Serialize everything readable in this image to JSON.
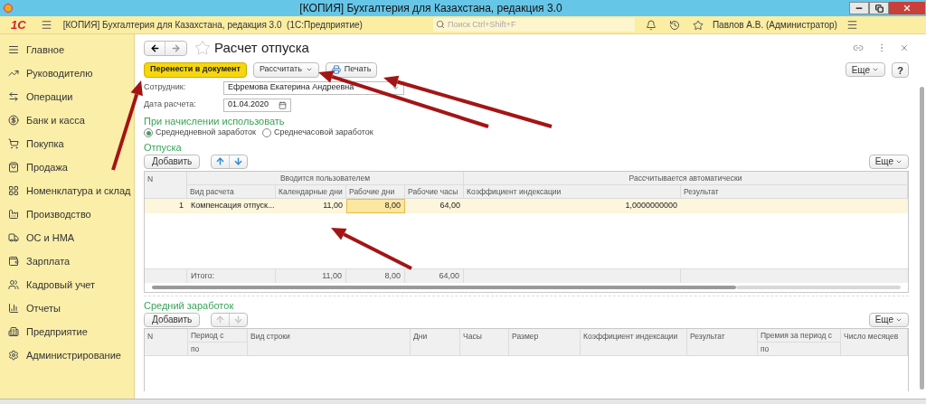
{
  "window": {
    "title": "[КОПИЯ] Бухгалтерия для Казахстана, редакция 3.0"
  },
  "app_bar": {
    "logo": "1С",
    "title": "[КОПИЯ] Бухгалтерия для Казахстана, редакция 3.0  (1С:Предприятие)",
    "search": {
      "placeholder": "Поиск Ctrl+Shift+F"
    },
    "user": "Павлов А.В. (Администратор)"
  },
  "sidebar": {
    "items": [
      {
        "label": "Главное"
      },
      {
        "label": "Руководителю"
      },
      {
        "label": "Операции"
      },
      {
        "label": "Банк и касса"
      },
      {
        "label": "Покупка"
      },
      {
        "label": "Продажа"
      },
      {
        "label": "Номенклатура и склад"
      },
      {
        "label": "Производство"
      },
      {
        "label": "ОС и НМА"
      },
      {
        "label": "Зарплата"
      },
      {
        "label": "Кадровый учет"
      },
      {
        "label": "Отчеты"
      },
      {
        "label": "Предприятие"
      },
      {
        "label": "Администрирование"
      }
    ]
  },
  "form": {
    "title": "Расчет отпуска",
    "more": "Еще",
    "help": "?",
    "buttons": [
      {
        "label": "Перенести в документ",
        "kind": "primary"
      },
      {
        "label": "Рассчитать",
        "kind": "dropdown"
      },
      {
        "label": "Печать",
        "kind": "print"
      }
    ],
    "fields": [
      {
        "label": "Сотрудник:",
        "value": "Ефремова Екатерина Андреевна",
        "kind": "select"
      },
      {
        "label": "Дата расчета:",
        "value": "01.04.2020",
        "kind": "date"
      }
    ],
    "group_label": "При начислении использовать",
    "radios": [
      {
        "label": "Среднедневной заработок",
        "selected": true
      },
      {
        "label": "Среднечасовой заработок",
        "selected": false
      }
    ],
    "vacations": {
      "title": "Отпуска",
      "add": "Добавить",
      "more": "Еще",
      "arrows_enabled": true,
      "group_headers": [
        "Вводится пользователем",
        "Рассчитывается автоматически"
      ],
      "columns": [
        {
          "label": "N",
          "kind": "number"
        },
        {
          "label": "Вид расчета",
          "kind": "text"
        },
        {
          "label": "Календарные дни",
          "kind": "number"
        },
        {
          "label": "Рабочие дни",
          "kind": "number"
        },
        {
          "label": "Рабочие часы",
          "kind": "number"
        },
        {
          "label": "Коэффициент индексации",
          "kind": "number"
        },
        {
          "label": "Результат",
          "kind": "number"
        }
      ],
      "rows": [
        {
          "selected": true,
          "cells": [
            {
              "text": "1",
              "focused": false
            },
            {
              "text": "Компенсация отпуск...",
              "focused": false
            },
            {
              "text": "11,00",
              "focused": false
            },
            {
              "text": "8,00",
              "focused": true
            },
            {
              "text": "64,00",
              "focused": false
            },
            {
              "text": "1,0000000000",
              "focused": false
            }
          ]
        }
      ],
      "totals": {
        "label": "Итого:",
        "values": [
          "11,00",
          "8,00",
          "64,00"
        ]
      }
    },
    "avg_earnings": {
      "title": "Средний заработок",
      "add": "Добавить",
      "more": "Еще",
      "arrows_enabled": false,
      "columns": [
        {
          "label": "N"
        },
        {
          "label": "Период с",
          "sublabel": "по"
        },
        {
          "label": "Вид строки"
        },
        {
          "label": "Дни"
        },
        {
          "label": "Часы"
        },
        {
          "label": "Размер"
        },
        {
          "label": "Коэффициент индексации"
        },
        {
          "label": "Результат"
        },
        {
          "label": "Премия за период с",
          "sublabel": "по"
        },
        {
          "label": "Число месяцев"
        }
      ]
    }
  }
}
